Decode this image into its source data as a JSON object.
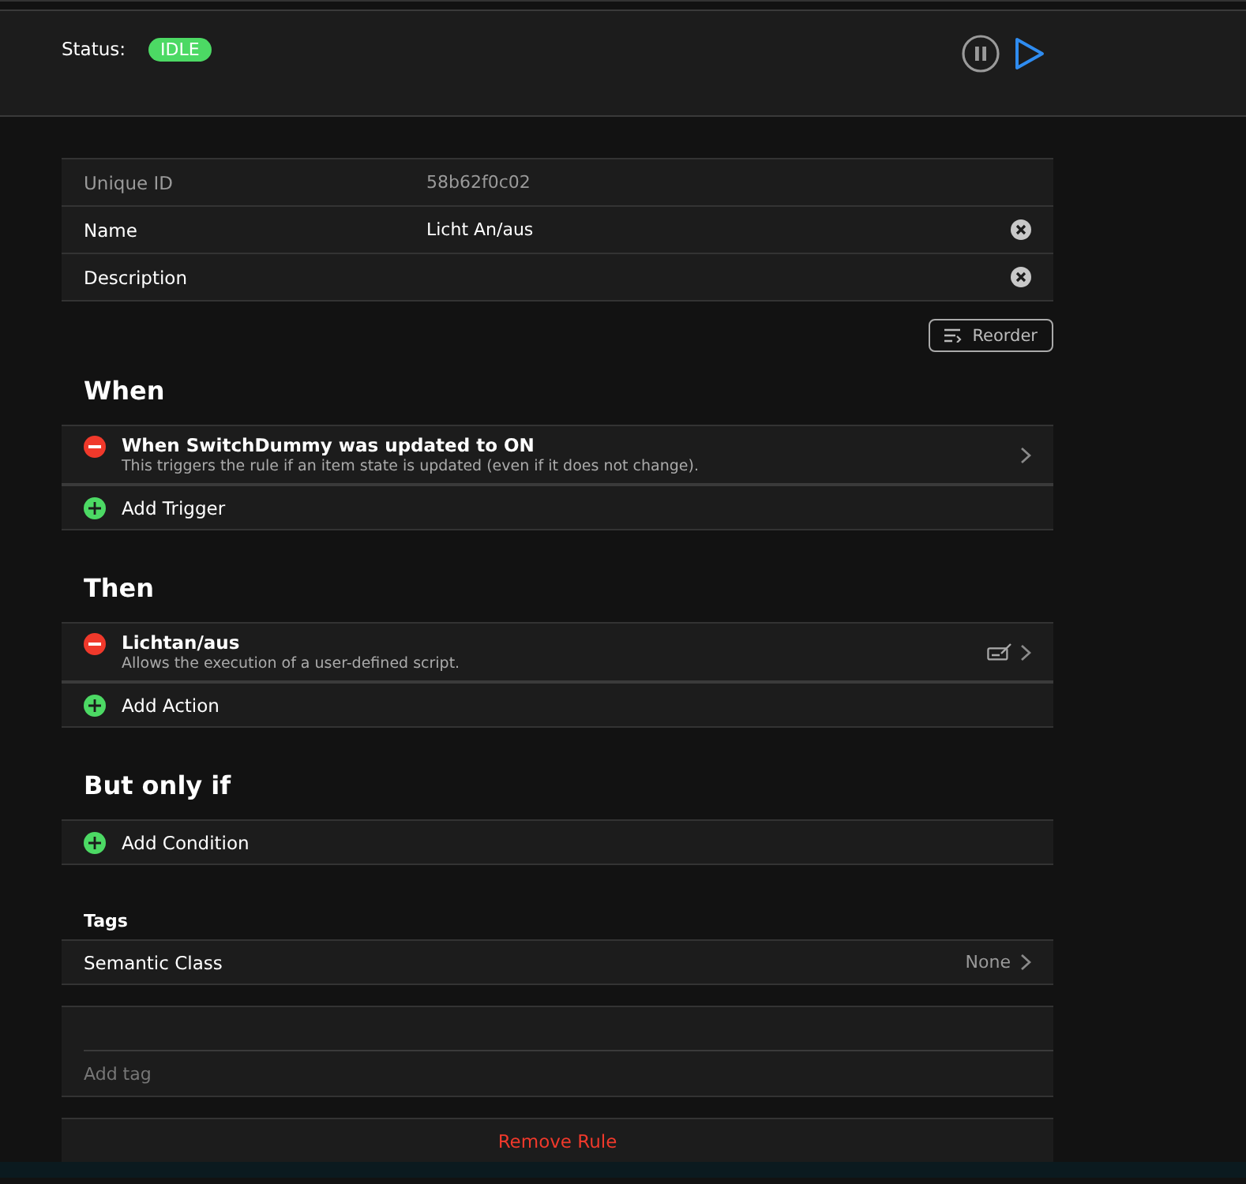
{
  "status": {
    "label": "Status:",
    "badge": "IDLE"
  },
  "controls": {
    "paused": false
  },
  "properties": [
    {
      "label": "Unique ID",
      "value": "58b62f0c02",
      "editable": false
    },
    {
      "label": "Name",
      "value": "Licht An/aus",
      "editable": true
    },
    {
      "label": "Description",
      "editable": true
    }
  ],
  "reorder_button": "Reorder",
  "sections": [
    {
      "heading": "When",
      "items": [
        {
          "title": "When SwitchDummy was updated to ON",
          "subtitle": "This triggers the rule if an item state is updated (even if it does not change).",
          "editable": false
        }
      ],
      "add_label": "Add Trigger"
    },
    {
      "heading": "Then",
      "items": [
        {
          "title": "Lichtan/aus",
          "subtitle": "Allows the execution of a user-defined script.",
          "editable": true
        }
      ],
      "add_label": "Add Action"
    },
    {
      "heading": "But only if",
      "add_label": "Add Condition"
    }
  ],
  "tags": {
    "heading": "Tags",
    "semantic_label": "Semantic Class",
    "semantic_value": "None",
    "placeholder": "Add tag"
  },
  "remove_button": "Remove Rule"
}
